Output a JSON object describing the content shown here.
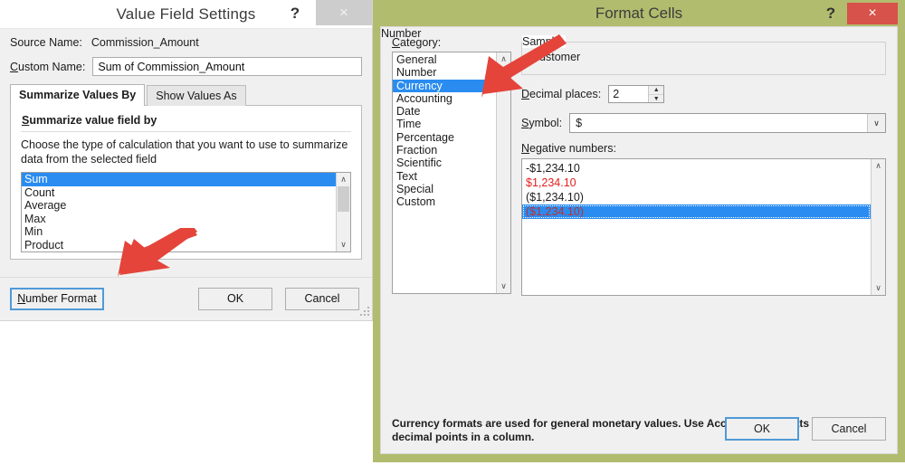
{
  "value_field_settings": {
    "title": "Value Field Settings",
    "help_icon": "?",
    "close_icon": "×",
    "source_name_label": "Source Name:",
    "source_name_value": "Commission_Amount",
    "custom_name_label": "Custom Name:",
    "custom_name_value": "Sum of Commission_Amount",
    "tabs": [
      {
        "label": "Summarize Values By",
        "active": true
      },
      {
        "label": "Show Values As",
        "active": false
      }
    ],
    "panel_heading": "Summarize value field by",
    "panel_description": "Choose the type of calculation that you want to use to summarize data from the selected field",
    "calculation_options": [
      "Sum",
      "Count",
      "Average",
      "Max",
      "Min",
      "Product"
    ],
    "selected_calculation": "Sum",
    "buttons": {
      "number_format": "Number Format",
      "ok": "OK",
      "cancel": "Cancel"
    }
  },
  "format_cells": {
    "title": "Format Cells",
    "help_icon": "?",
    "close_icon": "×",
    "tabs": [
      {
        "label": "Number",
        "active": true
      }
    ],
    "category_label": "Category:",
    "categories": [
      "General",
      "Number",
      "Currency",
      "Accounting",
      "Date",
      "Time",
      "Percentage",
      "Fraction",
      "Scientific",
      "Text",
      "Special",
      "Custom"
    ],
    "selected_category": "Currency",
    "sample_label": "Sample",
    "sample_value": "Customer",
    "decimal_places_label": "Decimal places:",
    "decimal_places_value": "2",
    "symbol_label": "Symbol:",
    "symbol_value": "$",
    "negative_numbers_label": "Negative numbers:",
    "negative_numbers": [
      {
        "text": "-$1,234.10",
        "color": "#1c1c1c",
        "selected": false
      },
      {
        "text": "$1,234.10",
        "color": "#e02020",
        "selected": false
      },
      {
        "text": "($1,234.10)",
        "color": "#1c1c1c",
        "selected": false
      },
      {
        "text": "($1,234.10)",
        "color": "#c03030",
        "selected": true
      }
    ],
    "description": "Currency formats are used for general monetary values.  Use Accounting formats to align decimal points in a column.",
    "buttons": {
      "ok": "OK",
      "cancel": "Cancel"
    }
  },
  "annotations": {
    "arrow_color": "#e4443a",
    "arrows": [
      {
        "name": "arrow-to-number-format",
        "points_to": "Number Format"
      },
      {
        "name": "arrow-to-category-list",
        "points_to": "Category"
      }
    ]
  },
  "scrollbars": {
    "up_arrow": "∧",
    "down_arrow": "∨"
  }
}
